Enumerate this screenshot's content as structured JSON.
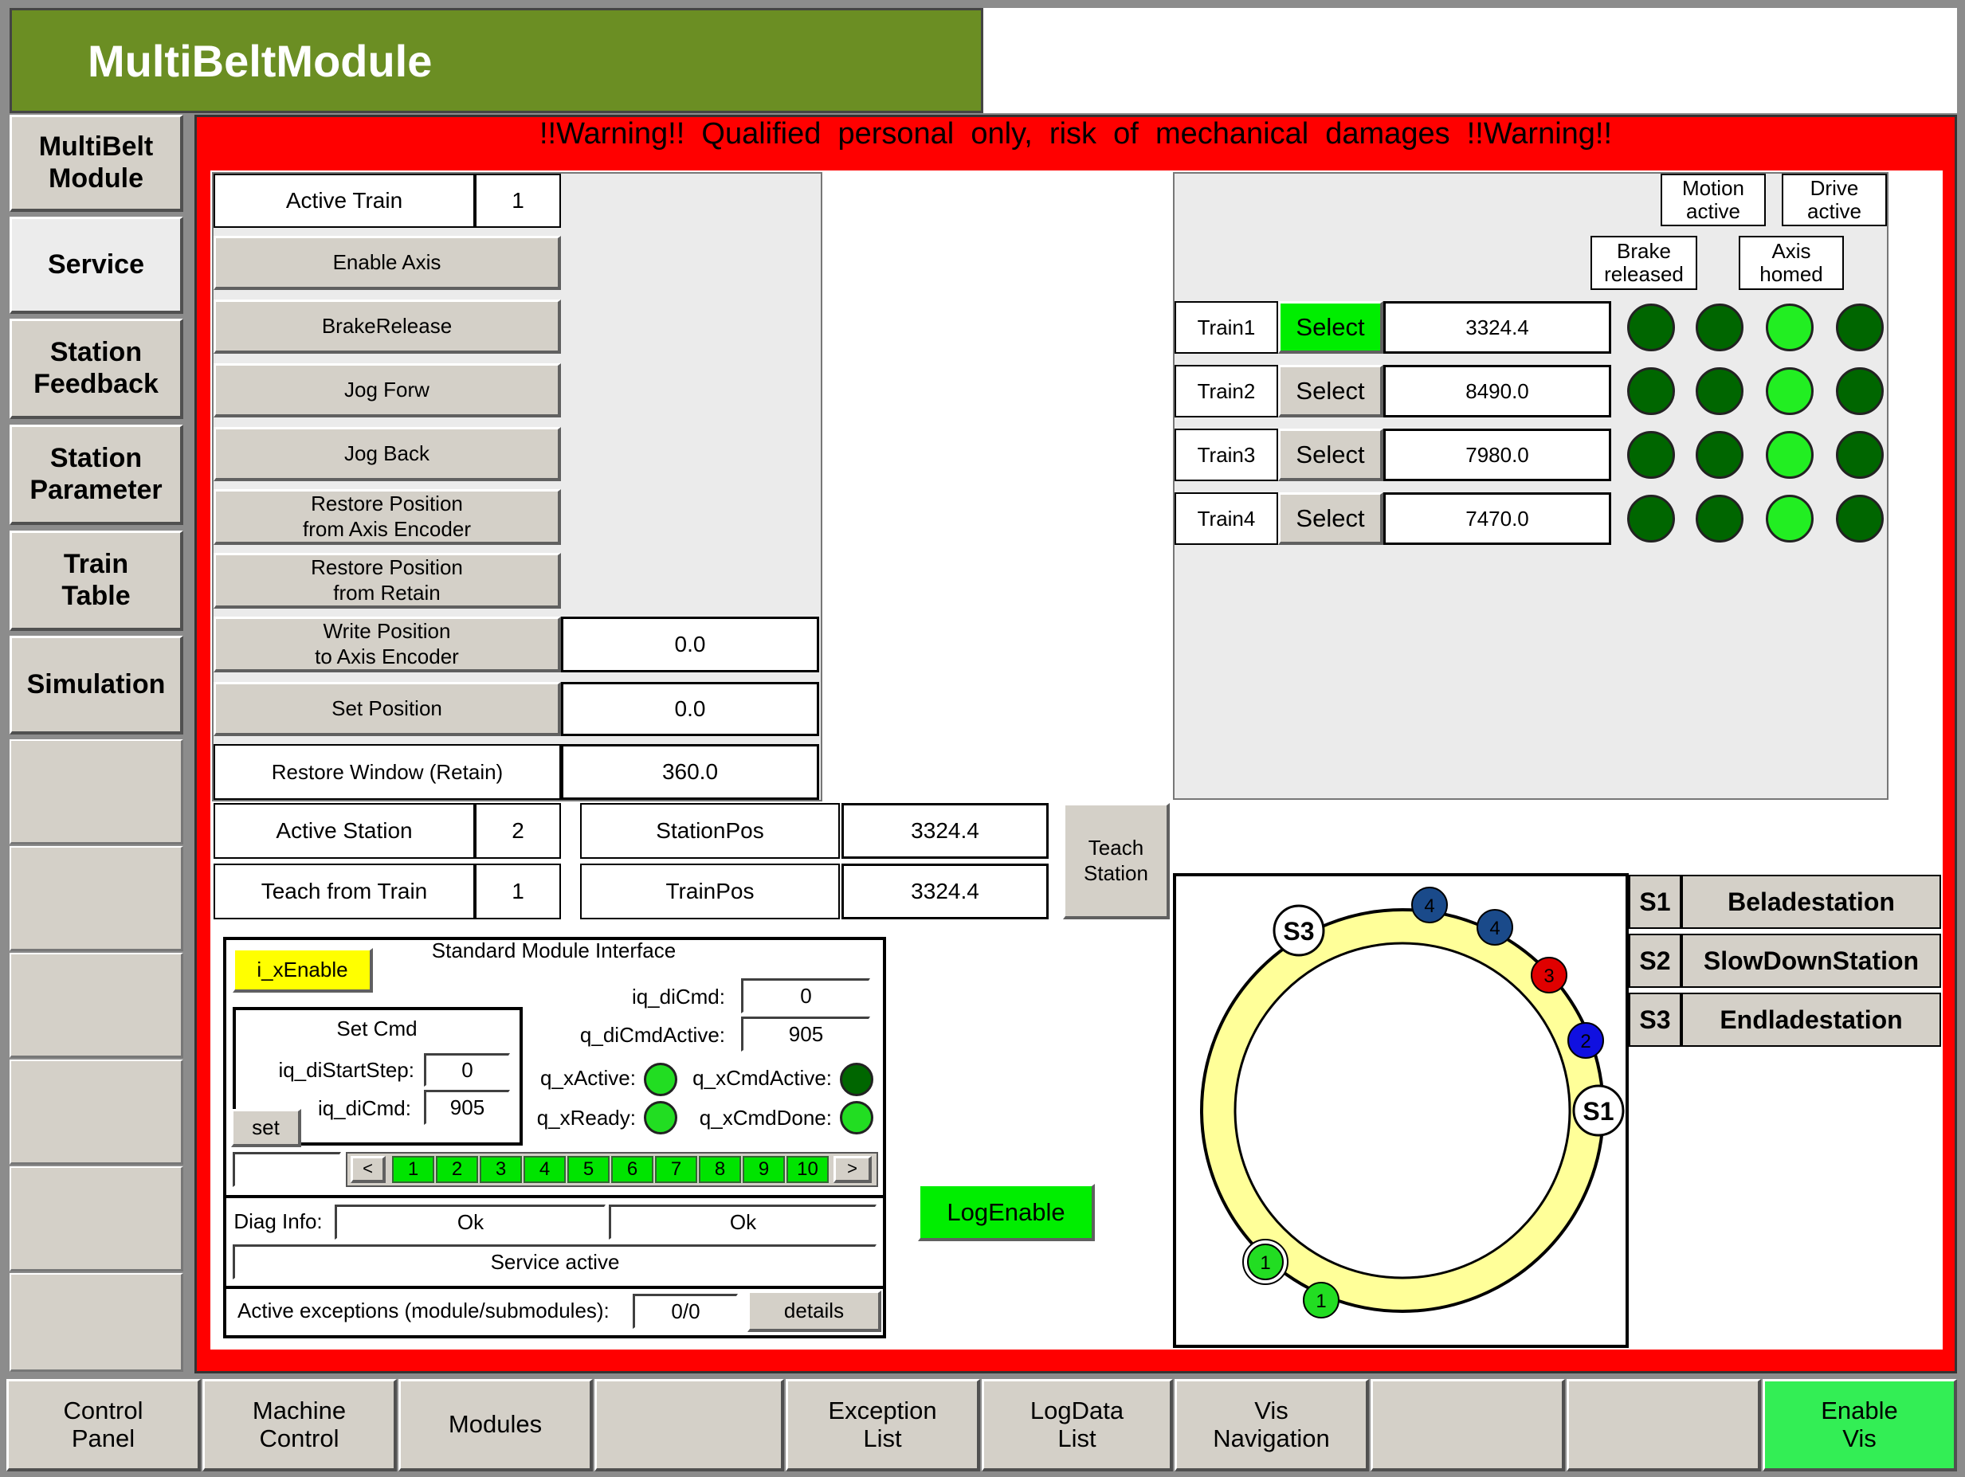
{
  "header": {
    "title": "MultiBeltModule"
  },
  "warning": "!!Warning!!  Qualified  personal  only,  risk  of  mechanical  damages  !!Warning!!",
  "sidebar": {
    "items": [
      {
        "label": "MultiBelt\nModule"
      },
      {
        "label": "Service"
      },
      {
        "label": "Station\nFeedback"
      },
      {
        "label": "Station\nParameter"
      },
      {
        "label": "Train\nTable"
      },
      {
        "label": "Simulation"
      }
    ]
  },
  "service": {
    "active_train_label": "Active Train",
    "active_train_value": "1",
    "buttons": {
      "enable_axis": "Enable Axis",
      "brake_release": "BrakeRelease",
      "jog_forw": "Jog Forw",
      "jog_back": "Jog Back",
      "restore_encoder": "Restore Position\nfrom Axis Encoder",
      "restore_retain": "Restore Position\nfrom Retain",
      "write_position": "Write Position\nto Axis Encoder",
      "set_position": "Set Position"
    },
    "write_position_value": "0.0",
    "set_position_value": "0.0",
    "restore_window_label": "Restore Window (Retain)",
    "restore_window_value": "360.0",
    "active_station_label": "Active Station",
    "active_station_value": "2",
    "station_pos_label": "StationPos",
    "station_pos_value": "3324.4",
    "teach_from_train_label": "Teach from Train",
    "teach_from_train_value": "1",
    "train_pos_label": "TrainPos",
    "train_pos_value": "3324.4",
    "teach_station_button": "Teach\nStation"
  },
  "trains": {
    "headers": {
      "motion_active": "Motion\nactive",
      "drive_active": "Drive\nactive",
      "brake_released": "Brake\nreleased",
      "axis_homed": "Axis\nhomed"
    },
    "select_label": "Select",
    "rows": [
      {
        "name": "Train1",
        "position": "3324.4",
        "selected": true
      },
      {
        "name": "Train2",
        "position": "8490.0",
        "selected": false
      },
      {
        "name": "Train3",
        "position": "7980.0",
        "selected": false
      },
      {
        "name": "Train4",
        "position": "7470.0",
        "selected": false
      }
    ],
    "colors": {
      "led_dark": "#006600",
      "led_light": "#22ee22",
      "select_active": "#00ee00"
    }
  },
  "smi": {
    "title": "Standard Module Interface",
    "enable_button": "i_xEnable",
    "set_cmd_title": "Set Cmd",
    "start_step_label": "iq_diStartStep:",
    "start_step_value": "0",
    "set_cmd_label": "iq_diCmd:",
    "set_cmd_value": "905",
    "set_button": "set",
    "di_cmd_label": "iq_diCmd:",
    "di_cmd_value": "0",
    "di_cmd_active_label": "q_diCmdActive:",
    "di_cmd_active_value": "905",
    "x_active_label": "q_xActive:",
    "x_cmd_active_label": "q_xCmdActive:",
    "x_ready_label": "q_xReady:",
    "x_cmd_done_label": "q_xCmdDone:",
    "prev": "<",
    "next": ">",
    "steps": [
      "1",
      "2",
      "3",
      "4",
      "5",
      "6",
      "7",
      "8",
      "9",
      "10"
    ],
    "diag_label": "Diag Info:",
    "diag_1": "Ok",
    "diag_2": "Ok",
    "service_state": "Service active",
    "exceptions_label": "Active exceptions (module/submodules):",
    "exceptions_value": "0/0",
    "details_button": "details"
  },
  "log_enable": "LogEnable",
  "ring": {
    "stations": [
      {
        "tag": "S3"
      },
      {
        "tag": "S1"
      }
    ],
    "carriers": [
      {
        "num": "4",
        "color": "#1a4a8a"
      },
      {
        "num": "4",
        "color": "#1a4a8a"
      },
      {
        "num": "3",
        "color": "#e00000"
      },
      {
        "num": "2",
        "color": "#1010e0"
      },
      {
        "num": "1",
        "color": "#22dd22"
      },
      {
        "num": "1",
        "color": "#22dd22"
      }
    ],
    "ring_color": "#ffff99"
  },
  "station_legend": [
    {
      "tag": "S1",
      "name": "Beladestation"
    },
    {
      "tag": "S2",
      "name": "SlowDownStation"
    },
    {
      "tag": "S3",
      "name": "Endladestation"
    }
  ],
  "footer": {
    "buttons": [
      "Control\nPanel",
      "Machine\nControl",
      "Modules",
      "",
      "Exception\nList",
      "LogData\nList",
      "Vis\nNavigation",
      "",
      "",
      "Enable\nVis"
    ]
  }
}
